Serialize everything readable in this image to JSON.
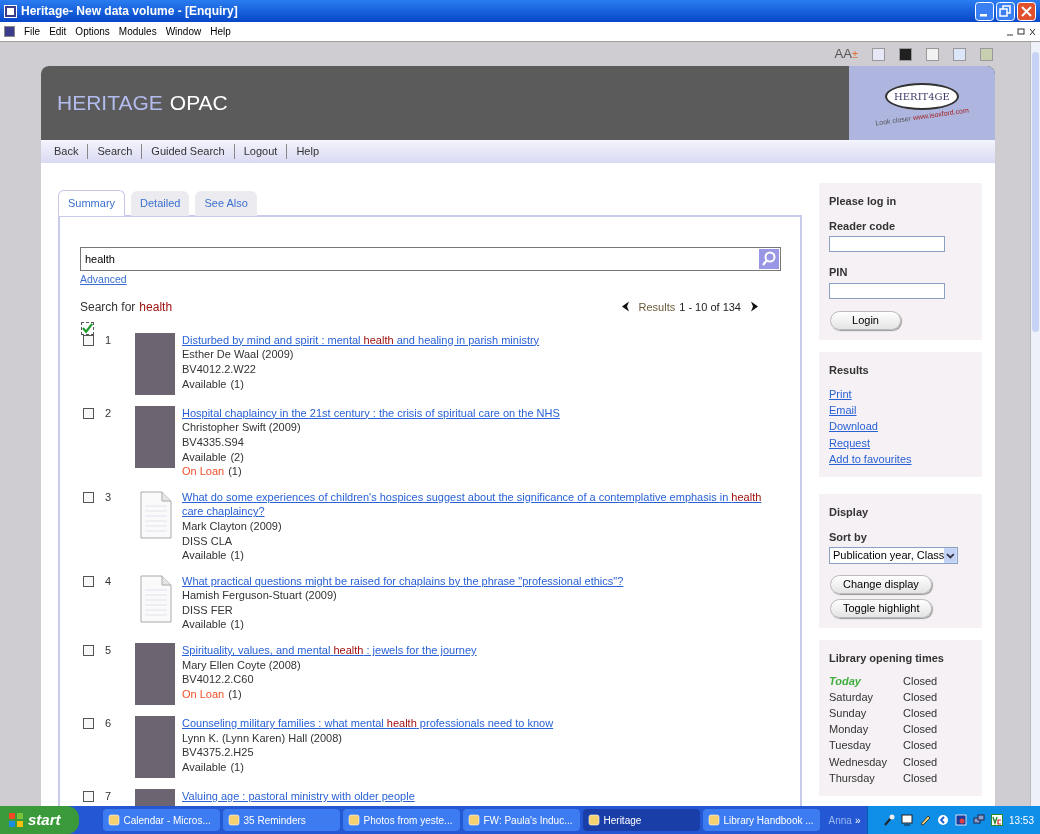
{
  "window": {
    "title": "Heritage- New data volume - [Enquiry]"
  },
  "menu": [
    "File",
    "Edit",
    "Options",
    "Modules",
    "Window",
    "Help"
  ],
  "display_toolbar": {
    "text_size": "AA",
    "text_size_sign": "±",
    "swatches": [
      {
        "color": "#e6e8f8"
      },
      {
        "color": "#202020"
      },
      {
        "color": "#f2f2f2"
      },
      {
        "color": "#dce6fa"
      },
      {
        "color": "#c8cfb0"
      }
    ]
  },
  "header": {
    "title_first": "HERITAGE",
    "title_second": "OPAC",
    "logo_text": "HERIT4GE",
    "tagline": "Look closer",
    "tagline_url": "www.isoxford.com"
  },
  "nav": [
    "Back",
    "Search",
    "Guided Search",
    "Logout",
    "Help"
  ],
  "tabs": [
    {
      "label": "Summary",
      "selected": true
    },
    {
      "label": "Detailed",
      "selected": false
    },
    {
      "label": "See Also",
      "selected": false
    }
  ],
  "search": {
    "value": "health",
    "advanced": "Advanced"
  },
  "search_for": {
    "label": "Search for",
    "term": "health"
  },
  "pagination": {
    "label": "Results",
    "range": "1 - 10 of 134"
  },
  "select_all": {
    "checked": true
  },
  "results": [
    {
      "number": "1",
      "checked": false,
      "kind": "photo",
      "title": [
        {
          "text": "Disturbed by mind and spirit : mental ",
          "highlight": false
        },
        {
          "text": "health",
          "highlight": true
        },
        {
          "text": " and healing in parish ministry",
          "highlight": false
        }
      ],
      "author": "Esther De Waal (2009)",
      "classmark": "BV4012.2.W22",
      "holdings": [
        {
          "status": "Available",
          "count": "(1)",
          "kind": "available"
        }
      ]
    },
    {
      "number": "2",
      "checked": false,
      "kind": "photo",
      "title": [
        {
          "text": "Hospital chaplaincy in the 21st century : the crisis of spiritual care on the NHS",
          "highlight": false
        }
      ],
      "author": "Christopher Swift (2009)",
      "classmark": "BV4335.S94",
      "holdings": [
        {
          "status": "Available",
          "count": "(2)",
          "kind": "available"
        },
        {
          "status": "On Loan",
          "count": "(1)",
          "kind": "on_loan"
        }
      ]
    },
    {
      "number": "3",
      "checked": false,
      "kind": "document",
      "title": [
        {
          "text": "What do some experiences of children's hospices suggest about the significance of a contemplative emphasis in ",
          "highlight": false
        },
        {
          "text": "health",
          "highlight": true
        },
        {
          "text": " care chaplaincy?",
          "highlight": false
        }
      ],
      "author": "Mark Clayton (2009)",
      "classmark": "DISS CLA",
      "holdings": [
        {
          "status": "Available",
          "count": "(1)",
          "kind": "available"
        }
      ]
    },
    {
      "number": "4",
      "checked": false,
      "kind": "document",
      "title": [
        {
          "text": "What practical questions might be raised for chaplains by the phrase \"professional ethics\"?",
          "highlight": false
        }
      ],
      "author": "Hamish Ferguson-Stuart (2009)",
      "classmark": "DISS FER",
      "holdings": [
        {
          "status": "Available",
          "count": "(1)",
          "kind": "available"
        }
      ]
    },
    {
      "number": "5",
      "checked": false,
      "kind": "photo",
      "title": [
        {
          "text": "Spirituality, values, and mental ",
          "highlight": false
        },
        {
          "text": "health",
          "highlight": true
        },
        {
          "text": " : jewels for the journey",
          "highlight": false
        }
      ],
      "author": "Mary Ellen Coyte (2008)",
      "classmark": "BV4012.2.C60",
      "holdings": [
        {
          "status": "On Loan",
          "count": "(1)",
          "kind": "on_loan"
        }
      ]
    },
    {
      "number": "6",
      "checked": false,
      "kind": "photo",
      "title": [
        {
          "text": "Counseling military families : what mental ",
          "highlight": false
        },
        {
          "text": "health",
          "highlight": true
        },
        {
          "text": " professionals need to know",
          "highlight": false
        }
      ],
      "author": "Lynn K. (Lynn Karen) Hall (2008)",
      "classmark": "BV4375.2.H25",
      "holdings": [
        {
          "status": "Available",
          "count": "(1)",
          "kind": "available"
        }
      ]
    },
    {
      "number": "7",
      "checked": false,
      "kind": "photo",
      "title": [
        {
          "text": "Valuing age : pastoral ministry with older people",
          "highlight": false
        }
      ]
    }
  ],
  "login": {
    "heading": "Please log in",
    "reader_code_label": "Reader code",
    "pin_label": "PIN",
    "button": "Login"
  },
  "results_actions": {
    "heading": "Results",
    "links": [
      "Print",
      "Email",
      "Download",
      "Request",
      "Add to favourites"
    ]
  },
  "display": {
    "heading": "Display",
    "sort_label": "Sort by",
    "sort_value": "Publication year, Class",
    "buttons": [
      "Change display",
      "Toggle highlight"
    ]
  },
  "opening_times": {
    "heading": "Library opening times",
    "days": [
      {
        "day": "Today",
        "hours": "Closed",
        "today": true
      },
      {
        "day": "Saturday",
        "hours": "Closed",
        "today": false
      },
      {
        "day": "Sunday",
        "hours": "Closed",
        "today": false
      },
      {
        "day": "Monday",
        "hours": "Closed",
        "today": false
      },
      {
        "day": "Tuesday",
        "hours": "Closed",
        "today": false
      },
      {
        "day": "Wednesday",
        "hours": "Closed",
        "today": false
      },
      {
        "day": "Thursday",
        "hours": "Closed",
        "today": false
      }
    ]
  },
  "taskbar": {
    "start": "start",
    "items": [
      {
        "label": "Calendar - Micros...",
        "selected": false
      },
      {
        "label": "35 Reminders",
        "selected": false
      },
      {
        "label": "Photos from yeste...",
        "selected": false
      },
      {
        "label": "FW: Paula's Induc...",
        "selected": false
      },
      {
        "label": "Heritage",
        "selected": true
      },
      {
        "label": "Library Handbook ...",
        "selected": false
      }
    ],
    "user": "Anna",
    "more": "»",
    "clock": "13:53"
  }
}
